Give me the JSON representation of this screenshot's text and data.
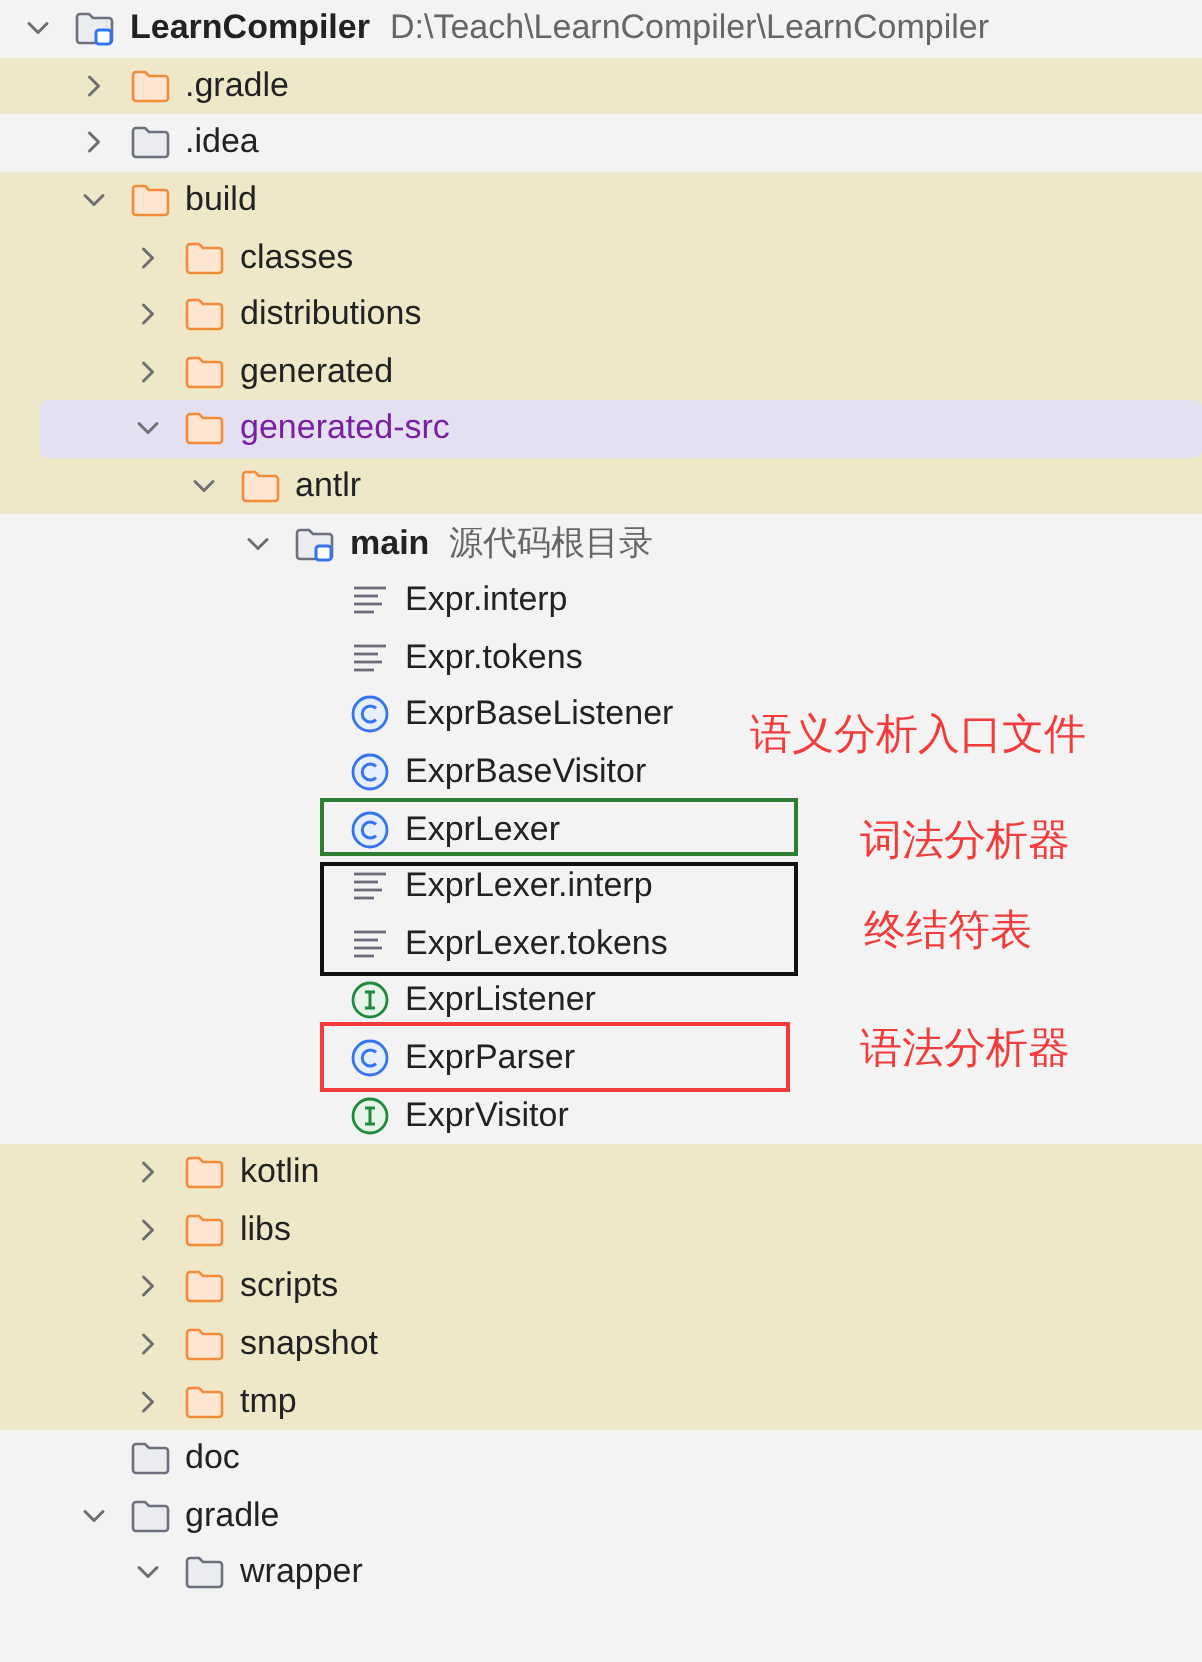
{
  "tree": {
    "label": "LearnCompiler",
    "path": "D:\\Teach\\LearnCompiler\\LearnCompiler",
    "kind": "module",
    "expanded": true,
    "excluded": false,
    "selected": false,
    "children": [
      {
        "label": ".gradle",
        "kind": "folder",
        "expanded": false,
        "excluded": true,
        "selected": false
      },
      {
        "label": ".idea",
        "kind": "folder",
        "expanded": false,
        "excluded": false,
        "selected": false
      },
      {
        "label": "build",
        "kind": "folder",
        "expanded": true,
        "excluded": true,
        "selected": false,
        "children": [
          {
            "label": "classes",
            "kind": "folder",
            "expanded": false,
            "excluded": true,
            "selected": false
          },
          {
            "label": "distributions",
            "kind": "folder",
            "expanded": false,
            "excluded": true,
            "selected": false
          },
          {
            "label": "generated",
            "kind": "folder",
            "expanded": false,
            "excluded": true,
            "selected": false
          },
          {
            "label": "generated-src",
            "kind": "folder",
            "expanded": true,
            "excluded": true,
            "selected": true,
            "children": [
              {
                "label": "antlr",
                "kind": "folder",
                "expanded": true,
                "excluded": true,
                "selected": false,
                "children": [
                  {
                    "label": "main",
                    "note": "源代码根目录",
                    "kind": "source-root",
                    "expanded": true,
                    "excluded": false,
                    "selected": false,
                    "children": [
                      {
                        "label": "Expr.interp",
                        "kind": "text-file",
                        "excluded": false,
                        "selected": false
                      },
                      {
                        "label": "Expr.tokens",
                        "kind": "text-file",
                        "excluded": false,
                        "selected": false
                      },
                      {
                        "label": "ExprBaseListener",
                        "kind": "class",
                        "excluded": false,
                        "selected": false
                      },
                      {
                        "label": "ExprBaseVisitor",
                        "kind": "class",
                        "excluded": false,
                        "selected": false
                      },
                      {
                        "label": "ExprLexer",
                        "kind": "class",
                        "excluded": false,
                        "selected": false
                      },
                      {
                        "label": "ExprLexer.interp",
                        "kind": "text-file",
                        "excluded": false,
                        "selected": false
                      },
                      {
                        "label": "ExprLexer.tokens",
                        "kind": "text-file",
                        "excluded": false,
                        "selected": false
                      },
                      {
                        "label": "ExprListener",
                        "kind": "interface",
                        "excluded": false,
                        "selected": false
                      },
                      {
                        "label": "ExprParser",
                        "kind": "class",
                        "excluded": false,
                        "selected": false
                      },
                      {
                        "label": "ExprVisitor",
                        "kind": "interface",
                        "excluded": false,
                        "selected": false
                      }
                    ]
                  }
                ]
              }
            ]
          },
          {
            "label": "kotlin",
            "kind": "folder",
            "expanded": false,
            "excluded": true,
            "selected": false
          },
          {
            "label": "libs",
            "kind": "folder",
            "expanded": false,
            "excluded": true,
            "selected": false
          },
          {
            "label": "scripts",
            "kind": "folder",
            "expanded": false,
            "excluded": true,
            "selected": false
          },
          {
            "label": "snapshot",
            "kind": "folder",
            "expanded": false,
            "excluded": true,
            "selected": false
          },
          {
            "label": "tmp",
            "kind": "folder",
            "expanded": false,
            "excluded": true,
            "selected": false
          }
        ]
      },
      {
        "label": "doc",
        "kind": "folder",
        "excluded": false,
        "selected": false
      },
      {
        "label": "gradle",
        "kind": "folder",
        "expanded": true,
        "excluded": false,
        "selected": false,
        "children": [
          {
            "label": "wrapper",
            "kind": "folder",
            "expanded": true,
            "excluded": false,
            "selected": false
          }
        ]
      }
    ]
  },
  "annotation_frames": [
    {
      "color": "#2e7d32"
    },
    {
      "color": "#111111"
    },
    {
      "color": "#f23b3b"
    }
  ],
  "annotation_notes": [
    {
      "text": "语义分析入口文件"
    },
    {
      "text": "词法分析器"
    },
    {
      "text": "终结符表"
    },
    {
      "text": "语法分析器"
    }
  ]
}
